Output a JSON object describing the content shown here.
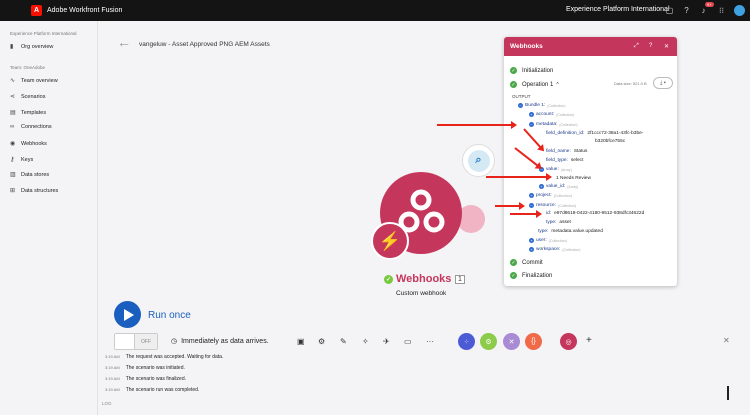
{
  "topbar": {
    "app_title": "Adobe Workfront Fusion",
    "org_name": "Experience Platform International",
    "notification_count": "9+",
    "icons": [
      "chat-icon",
      "help-icon",
      "bell-icon",
      "apps-grid-icon",
      "avatar"
    ]
  },
  "sidebar": {
    "org_section": "Experience Platform International",
    "org_item": "Org overview",
    "team_section": "Team: OneAdobe",
    "items": [
      {
        "label": "Team overview",
        "icon": "chart-icon"
      },
      {
        "label": "Scenarios",
        "icon": "share-icon"
      },
      {
        "label": "Templates",
        "icon": "template-icon"
      },
      {
        "label": "Connections",
        "icon": "link-icon"
      },
      {
        "label": "Webhooks",
        "icon": "globe-icon"
      },
      {
        "label": "Keys",
        "icon": "key-icon"
      },
      {
        "label": "Data stores",
        "icon": "database-icon"
      },
      {
        "label": "Data structures",
        "icon": "structure-icon"
      }
    ]
  },
  "scenario": {
    "title": "vangeluw - Asset Approved PNG AEM Assets"
  },
  "module": {
    "name": "Webhooks",
    "count": "1",
    "subtitle": "Custom webhook"
  },
  "panel": {
    "title": "Webhooks",
    "steps": {
      "initialization": "Initialization",
      "operation": "Operation 1",
      "commit": "Commit",
      "finalization": "Finalization"
    },
    "data_size": "Data size: 521.0 B",
    "output_label": "OUTPUT",
    "tree": {
      "bundle": "Bundle 1:",
      "bundle_tag": "(Collection)",
      "account": "account:",
      "account_tag": "(Collection)",
      "metadata": "metadata:",
      "metadata_tag": "(Collection)",
      "field_definition_id_key": "field_definition_id:",
      "field_definition_id_val1": "2f1ccc72-38a1-43fc-b3be-",
      "field_definition_id_val2": "b320bfce755c",
      "field_name_key": "field_name:",
      "field_name_val": "Status",
      "field_type_key": "field_type:",
      "field_type_val": "select",
      "value_key": "value:",
      "value_tag": "(Array)",
      "value_item": "1  Needs Review",
      "value_id": "value_id:",
      "value_id_tag": "(Array)",
      "project": "project:",
      "project_tag": "(Collection)",
      "resource": "resource:",
      "resource_tag": "(Collection)",
      "id_key": "id:",
      "id_val": "e97d8618-0422-4180-9512-938dfc34622d",
      "type_key": "type:",
      "type_val": "asset",
      "type2_key": "type:",
      "type2_val": "metadata.value.updated",
      "user": "user:",
      "user_tag": "(Collection)",
      "workspace": "workspace:",
      "workspace_tag": "(Collection)"
    }
  },
  "controls": {
    "run_once": "Run once",
    "toggle_state": "OFF",
    "schedule": "Immediately as data arrives."
  },
  "log": {
    "label": "LOG",
    "entries": [
      {
        "time": "3:19 AM",
        "text": "The request was accepted. Waiting for data."
      },
      {
        "time": "3:19 AM",
        "text": "The scenario was initiated."
      },
      {
        "time": "3:19 AM",
        "text": "The scenario was finalized."
      },
      {
        "time": "3:19 AM",
        "text": "The scenario run was completed."
      }
    ]
  },
  "colors": {
    "module": "#c5365c",
    "run": "#1a5fbf",
    "arrow": "#e8231a",
    "success": "#4aa84a"
  }
}
